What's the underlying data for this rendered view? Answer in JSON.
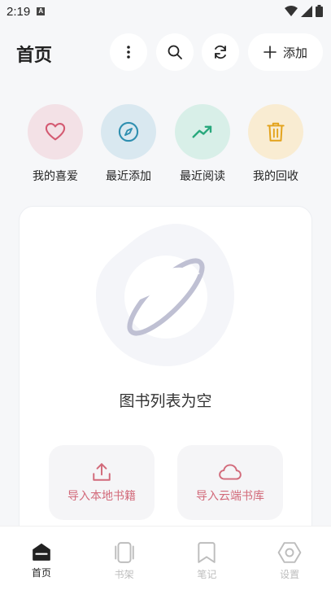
{
  "status_bar": {
    "time": "2:19",
    "notification_badge": "A"
  },
  "header": {
    "title": "首页",
    "add_label": "添加",
    "icons": [
      "more-vertical-icon",
      "search-icon",
      "refresh-icon",
      "plus-icon"
    ]
  },
  "quick_actions": [
    {
      "label": "我的喜爱",
      "icon": "heart-icon",
      "bg": "#f3e1e6",
      "fg": "#d45a72"
    },
    {
      "label": "最近添加",
      "icon": "compass-icon",
      "bg": "#d9e8f0",
      "fg": "#2f8fb0"
    },
    {
      "label": "最近阅读",
      "icon": "trending-up-icon",
      "bg": "#d8efe8",
      "fg": "#28a87c"
    },
    {
      "label": "我的回收",
      "icon": "trash-icon",
      "bg": "#f9ecd2",
      "fg": "#e3a21a"
    }
  ],
  "empty_state": {
    "message": "图书列表为空",
    "illustration": "planet-icon"
  },
  "import_buttons": [
    {
      "label": "导入本地书籍",
      "icon": "upload-icon"
    },
    {
      "label": "导入云端书库",
      "icon": "cloud-icon"
    }
  ],
  "bottom_nav": [
    {
      "label": "首页",
      "icon": "home-icon",
      "active": true
    },
    {
      "label": "书架",
      "icon": "bookshelf-icon",
      "active": false
    },
    {
      "label": "笔记",
      "icon": "bookmark-icon",
      "active": false
    },
    {
      "label": "设置",
      "icon": "settings-icon",
      "active": false
    }
  ],
  "colors": {
    "accent": "#d26a7a",
    "background": "#f6f7f9"
  }
}
